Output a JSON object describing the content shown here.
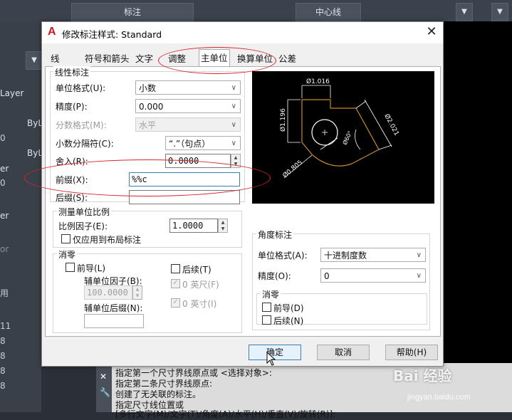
{
  "background": {
    "toolbar": {
      "dim_label": "标注",
      "centerline_label": "中心线"
    },
    "left_panel": {
      "items": [
        "Layer",
        "ByL",
        "0",
        "ByL",
        "er",
        "0",
        "er",
        "or",
        "用",
        "11",
        "8",
        "8",
        "8",
        "8"
      ]
    },
    "command_lines": [
      "指定第一个尺寸界线原点或 <选择对象>:",
      "指定第二条尺寸界线原点:",
      "创建了无关联的标注。",
      "指定尺寸线位置或",
      "[多行文字(M)/文字(T)/角度(A)/水平(H)/垂直(V)/旋转(R)]:"
    ],
    "watermark": "Bai 经验",
    "watermark_sub": "jingyan.baidu.com"
  },
  "dialog": {
    "title": "修改标注样式: Standard",
    "logo": "A",
    "close_icon": "✕",
    "tabs": [
      "线",
      "符号和箭头",
      "文字",
      "调整",
      "主单位",
      "换算单位",
      "公差"
    ],
    "active_tab": "主单位",
    "linear": {
      "group_label": "线性标注",
      "unit_format_label": "单位格式(U):",
      "unit_format_value": "小数",
      "precision_label": "精度(P):",
      "precision_value": "0.000",
      "fraction_label": "分数格式(M):",
      "fraction_value": "水平",
      "decimal_sep_label": "小数分隔符(C):",
      "decimal_sep_value": "“.”（句点）",
      "round_label": "舍入(R):",
      "round_value": "0.0000",
      "prefix_label": "前缀(X):",
      "prefix_value": "%%c",
      "suffix_label": "后缀(S):",
      "suffix_value": ""
    },
    "scale": {
      "group_label": "测量单位比例",
      "factor_label": "比例因子(E):",
      "factor_value": "1.0000",
      "layout_only_label": "仅应用到布局标注"
    },
    "zero_suppress": {
      "group_label": "消零",
      "leading_label": "前导(L)",
      "trailing_label": "后续(T)",
      "sub_factor_label": "辅单位因子(B):",
      "sub_factor_value": "100.0000",
      "sub_suffix_label": "辅单位后缀(N):",
      "zero_feet_label": "0 英尺(F)",
      "zero_inches_label": "0 英寸(I)"
    },
    "preview_labels": {
      "top": "Ø1.016",
      "left": "Ø1.196",
      "right": "Ø2.021",
      "angle": "Ø60°",
      "bottom": "Ø0.805"
    },
    "angular": {
      "group_label": "角度标注",
      "unit_format_label": "单位格式(A):",
      "unit_format_value": "十进制度数",
      "precision_label": "精度(O):",
      "precision_value": "0",
      "zero_label": "消零",
      "leading_label": "前导(D)",
      "trailing_label": "后续(N)"
    },
    "buttons": {
      "ok": "确定",
      "cancel": "取消",
      "help": "帮助(H)"
    }
  }
}
